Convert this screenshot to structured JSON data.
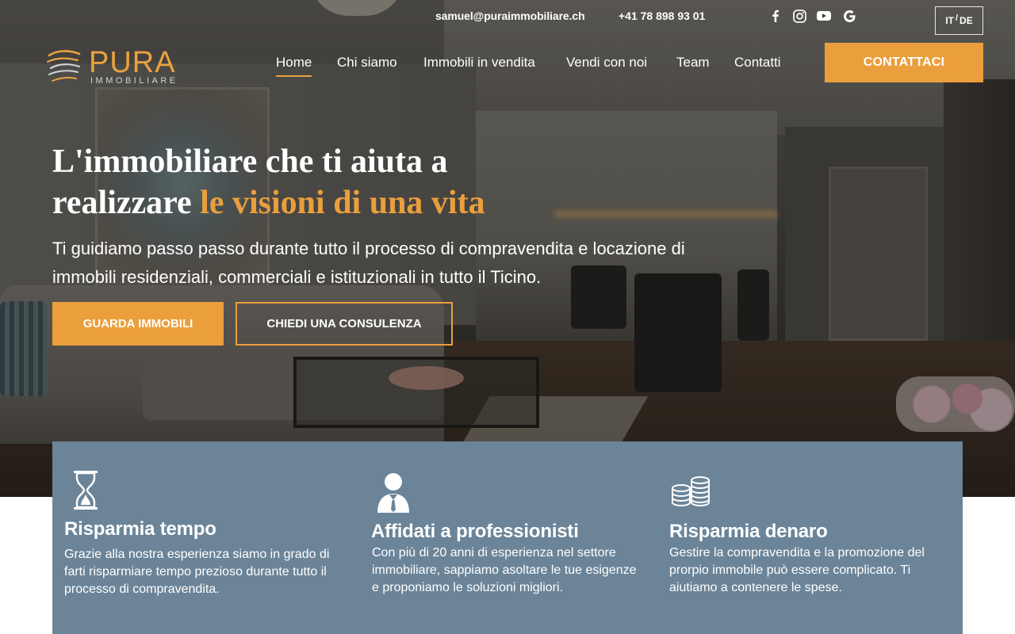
{
  "topbar": {
    "email": "samuel@puraimmobiliare.ch",
    "phone": "+41 78 898 93 01",
    "social": [
      "facebook-icon",
      "instagram-icon",
      "youtube-icon",
      "google-icon"
    ],
    "lang_it": "IT",
    "lang_sep": "/",
    "lang_de": "DE"
  },
  "logo": {
    "word": "PURA",
    "sub": "IMMOBILIARE"
  },
  "nav": {
    "items": [
      {
        "label": "Home",
        "active": true
      },
      {
        "label": "Chi siamo",
        "active": false
      },
      {
        "label": "Immobili in vendita",
        "active": false
      },
      {
        "label": "Vendi con noi",
        "active": false
      },
      {
        "label": "Team",
        "active": false
      },
      {
        "label": "Contatti",
        "active": false
      }
    ],
    "cta": "CONTATTACI"
  },
  "hero": {
    "headline_line1": "L'immobiliare che ti aiuta a",
    "headline_line2_plain": "realizzare ",
    "headline_line2_accent": "le visioni di una vita",
    "subtext": "Ti guidiamo passo passo durante tutto il processo di compravendita e locazione di immobili residenziali, commerciali e istituzionali in tutto il Ticino.",
    "btn_primary": "GUARDA IMMOBILI",
    "btn_secondary": "CHIEDI UNA CONSULENZA"
  },
  "features": [
    {
      "icon": "hourglass-icon",
      "title": "Risparmia tempo",
      "desc": "Grazie alla nostra esperienza siamo in grado di farti risparmiare tempo prezioso durante tutto il processo di compravendita."
    },
    {
      "icon": "businessman-icon",
      "title": "Affidati a professionisti",
      "desc": "Con più di 20 anni di esperienza nel settore immobiliare, sappiamo asoltare le tue esigenze e proponiamo le soluzioni migliori."
    },
    {
      "icon": "coins-icon",
      "title": "Risparmia denaro",
      "desc": "Gestire la compravendita e la promozione del prorpio immobile può essere complicato. Ti aiutiamo a contenere le spese."
    }
  ],
  "colors": {
    "accent": "#ea9f3c",
    "panel": "#6b8498"
  }
}
